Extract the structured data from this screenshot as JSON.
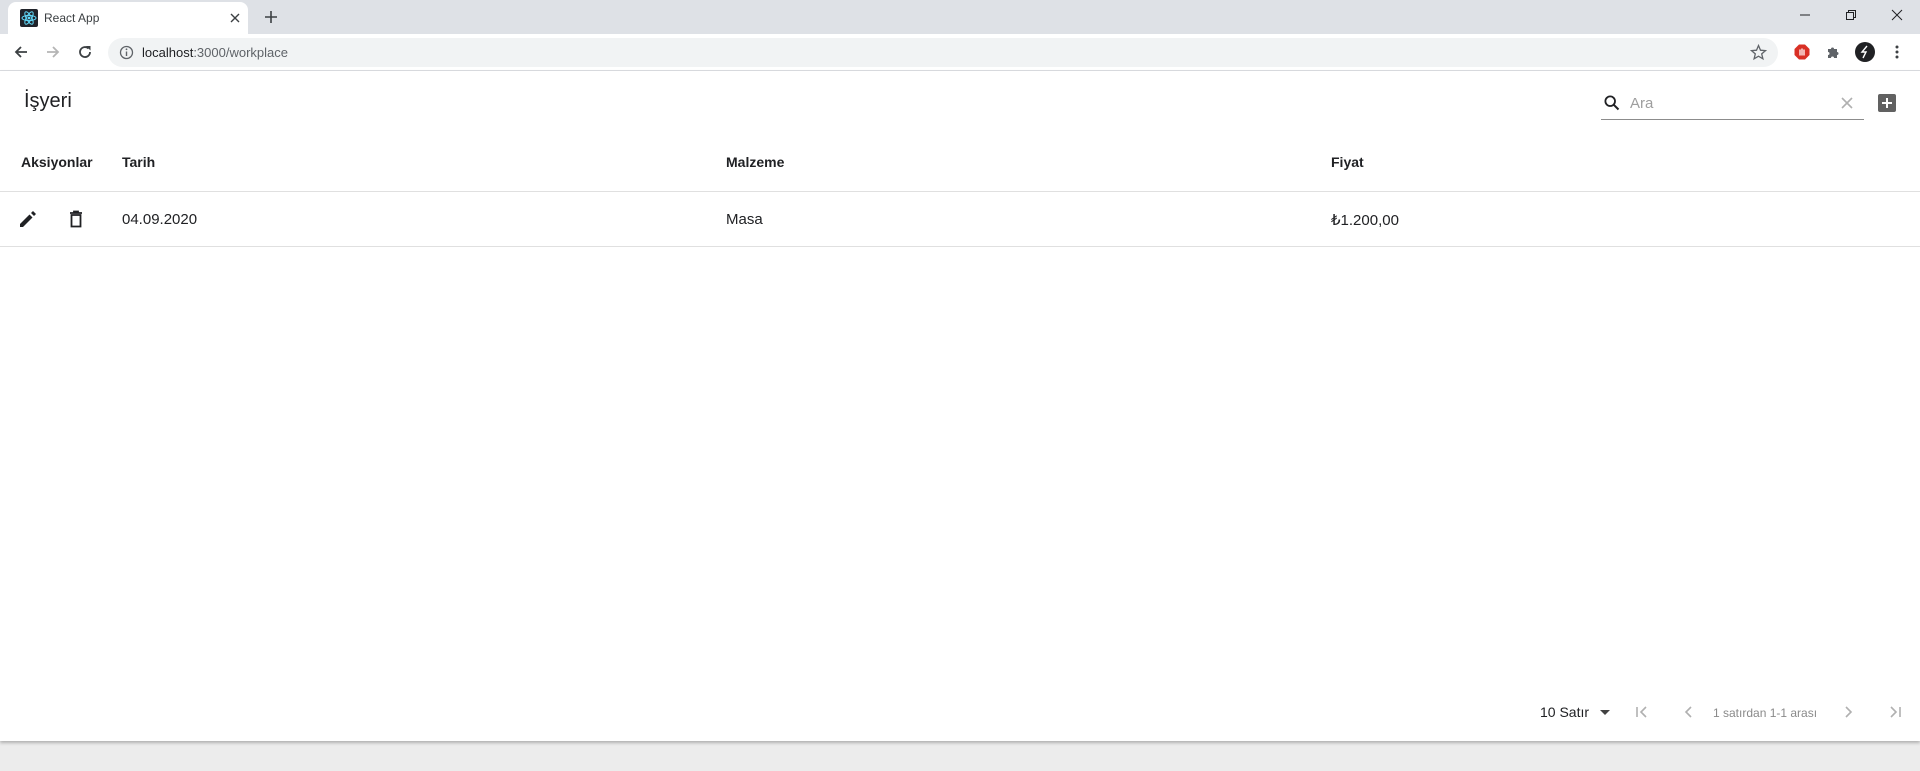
{
  "browser": {
    "tab_title": "React App",
    "url_host": "localhost",
    "url_path": ":3000/workplace"
  },
  "app": {
    "title": "İşyeri",
    "search": {
      "placeholder": "Ara",
      "value": ""
    }
  },
  "table": {
    "columns": [
      "Aksiyonlar",
      "Tarih",
      "Malzeme",
      "Fiyat"
    ],
    "rows": [
      {
        "tarih": "04.09.2020",
        "malzeme": "Masa",
        "fiyat": "₺1.200,00"
      }
    ]
  },
  "pagination": {
    "rows_per_page": "10 Satır",
    "range_text": "1 satırdan 1-1 arası"
  },
  "icons": {
    "favicon": "react-logo-icon",
    "row_actions": [
      "edit-icon",
      "delete-icon"
    ],
    "pagination": [
      "first-page-icon",
      "previous-page-icon",
      "next-page-icon",
      "last-page-icon"
    ]
  },
  "colors": {
    "extension_red": "#d93025",
    "react_blue": "#61dafb",
    "disabled_icon": "#b0b0b0"
  }
}
